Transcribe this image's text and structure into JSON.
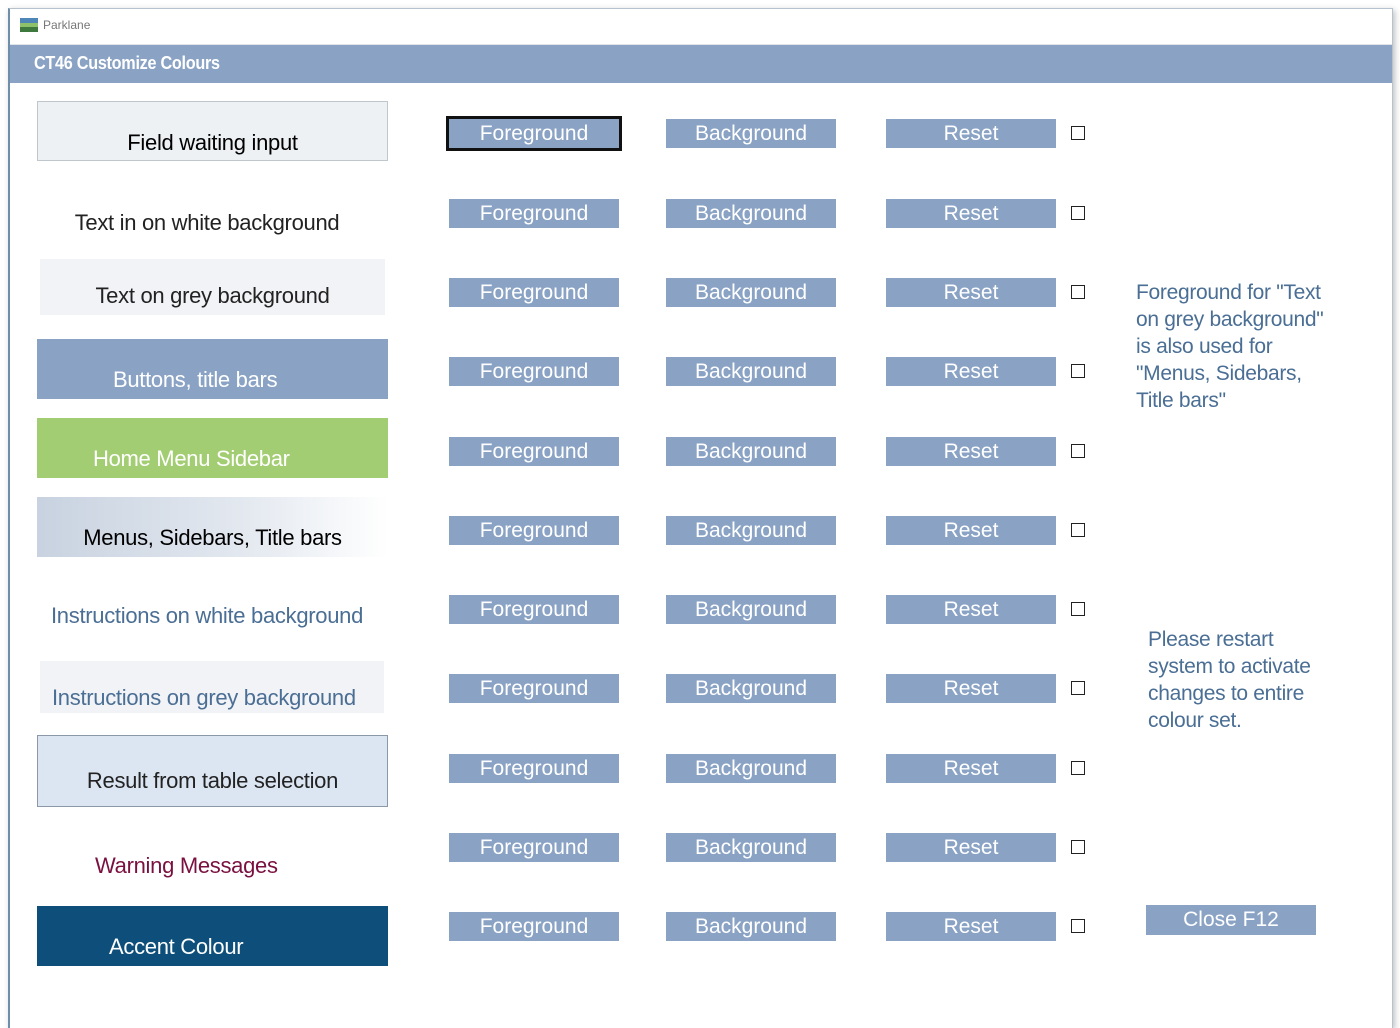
{
  "window": {
    "app_name": "Parklane"
  },
  "header": {
    "title": "CT46  Customize Colours"
  },
  "buttons": {
    "foreground": "Foreground",
    "background": "Background",
    "reset": "Reset"
  },
  "rows": [
    {
      "label": "Field waiting input",
      "text_color": "#000000",
      "bg_color": "#edf1f4"
    },
    {
      "label": "Text in on white background",
      "text_color": "#222222",
      "bg_color": "#ffffff"
    },
    {
      "label": "Text on grey background",
      "text_color": "#222222",
      "bg_color": "#f2f3f6"
    },
    {
      "label": "Buttons, title bars",
      "text_color": "#ffffff",
      "bg_color": "#8aa3c5"
    },
    {
      "label": "Home Menu Sidebar",
      "text_color": "#ffffff",
      "bg_color": "#a3cd72"
    },
    {
      "label": "Menus, Sidebars, Title bars",
      "text_color": "#000000",
      "bg_color": "#ccd5e2"
    },
    {
      "label": "Instructions on white background",
      "text_color": "#4a6e94",
      "bg_color": "#ffffff"
    },
    {
      "label": "Instructions on grey background",
      "text_color": "#4a6e94",
      "bg_color": "#f2f3f6"
    },
    {
      "label": "Result from table selection",
      "text_color": "#222222",
      "bg_color": "#dce6f3"
    },
    {
      "label": "Warning Messages",
      "text_color": "#7a1040",
      "bg_color": "#ffffff"
    },
    {
      "label": "Accent Colour",
      "text_color": "#ffffff",
      "bg_color": "#0d4f7a"
    }
  ],
  "notes": {
    "foreground_note": [
      "Foreground for  \"Text",
      "on grey background\"",
      "is also used for",
      "\"Menus, Sidebars,",
      "Title bars\""
    ],
    "restart_note": [
      "Please restart",
      "system to activate",
      "changes to entire",
      "colour set."
    ]
  },
  "close_button": "Close F12",
  "colors": {
    "accent": "#8aa3c5",
    "note_text": "#4a6e94"
  }
}
